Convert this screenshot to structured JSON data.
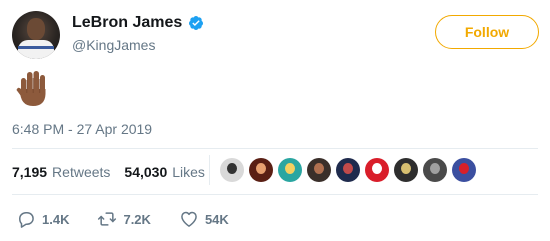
{
  "tweet": {
    "author_name": "LeBron James",
    "author_handle": "@KingJames",
    "verified": true,
    "follow_label": "Follow",
    "content_emoji": "raised-hand-medium-dark-skin-tone",
    "timestamp": "6:48 PM - 27 Apr 2019"
  },
  "stats": {
    "retweets_count": "7,195",
    "retweets_label": "Retweets",
    "likes_count": "54,030",
    "likes_label": "Likes"
  },
  "likers": [
    {
      "name": "liker-avatar-1",
      "bg": "#d9d9d9",
      "fg": "#333333"
    },
    {
      "name": "liker-avatar-2",
      "bg": "#5a1f14",
      "fg": "#e8a070"
    },
    {
      "name": "liker-avatar-3",
      "bg": "#2aa6a1",
      "fg": "#f4d060"
    },
    {
      "name": "liker-avatar-4",
      "bg": "#3a2f2a",
      "fg": "#b07050"
    },
    {
      "name": "liker-avatar-5",
      "bg": "#1f2b4d",
      "fg": "#c24a4a"
    },
    {
      "name": "liker-avatar-6",
      "bg": "#d91e2a",
      "fg": "#ffffff"
    },
    {
      "name": "liker-avatar-7",
      "bg": "#2e2e2e",
      "fg": "#d8c070"
    },
    {
      "name": "liker-avatar-8",
      "bg": "#4a4a4a",
      "fg": "#a0a0a0"
    },
    {
      "name": "liker-avatar-9",
      "bg": "#3b4fa0",
      "fg": "#d8202a"
    }
  ],
  "actions": {
    "replies": "1.4K",
    "retweets": "7.2K",
    "likes": "54K"
  },
  "colors": {
    "follow_accent": "#f2a900",
    "verified_blue": "#1da1f2",
    "muted_text": "#657786",
    "divider": "#e6ecf0"
  }
}
